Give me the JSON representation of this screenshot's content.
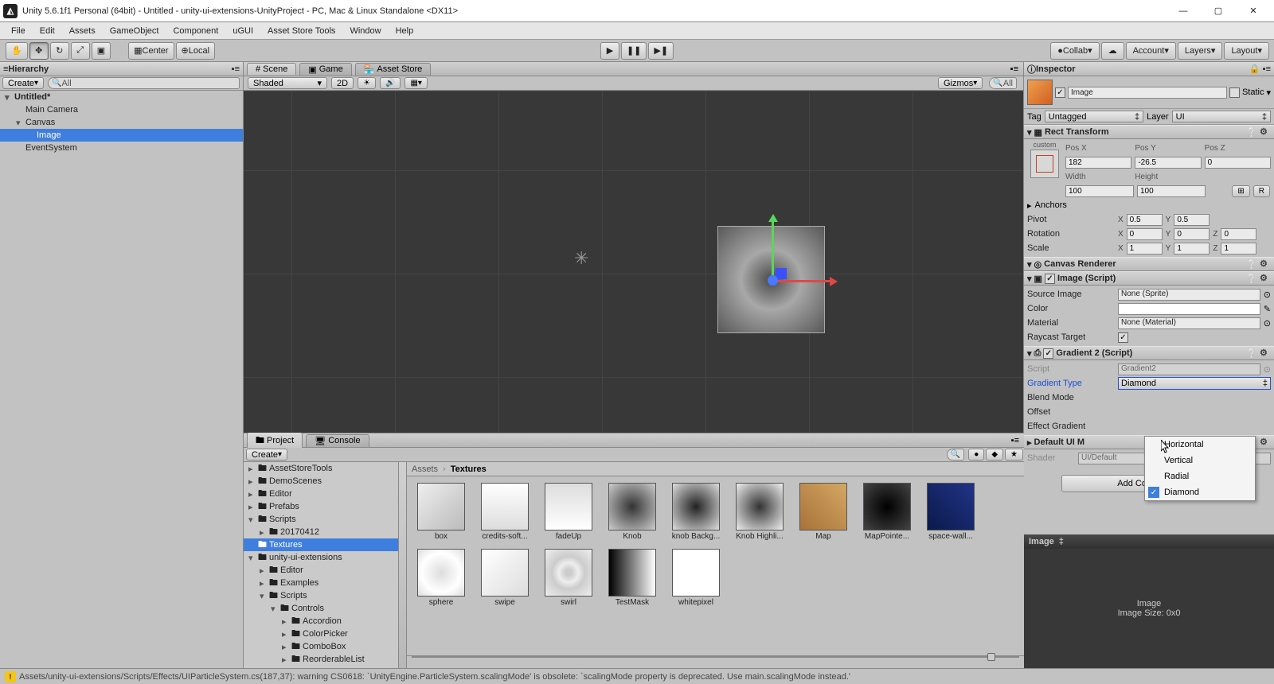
{
  "window": {
    "title": "Unity 5.6.1f1 Personal (64bit) - Untitled - unity-ui-extensions-UnityProject - PC, Mac & Linux Standalone <DX11>"
  },
  "menu": [
    "File",
    "Edit",
    "Assets",
    "GameObject",
    "Component",
    "uGUI",
    "Asset Store Tools",
    "Window",
    "Help"
  ],
  "toolbar": {
    "center": "Center",
    "local": "Local",
    "collab": "Collab",
    "account": "Account",
    "layers": "Layers",
    "layout": "Layout"
  },
  "hierarchy": {
    "tab": "Hierarchy",
    "create": "Create",
    "search_ph": "All",
    "rows": [
      {
        "label": "Untitled*",
        "depth": 0,
        "bold": true,
        "sel": false,
        "fold": "▾"
      },
      {
        "label": "Main Camera",
        "depth": 1,
        "sel": false
      },
      {
        "label": "Canvas",
        "depth": 1,
        "sel": false,
        "fold": "▾"
      },
      {
        "label": "Image",
        "depth": 2,
        "sel": true
      },
      {
        "label": "EventSystem",
        "depth": 1,
        "sel": false
      }
    ]
  },
  "scene": {
    "tabs": [
      "Scene",
      "Game",
      "Asset Store"
    ],
    "shaded": "Shaded",
    "mode2d": "2D",
    "gizmos": "Gizmos",
    "search_ph": "All"
  },
  "project": {
    "tab_project": "Project",
    "tab_console": "Console",
    "create": "Create",
    "breadcrumb": [
      "Assets",
      "Textures"
    ],
    "tree": [
      {
        "label": "AssetStoreTools",
        "depth": 0,
        "fold": "▸"
      },
      {
        "label": "DemoScenes",
        "depth": 0,
        "fold": "▸"
      },
      {
        "label": "Editor",
        "depth": 0,
        "fold": "▸"
      },
      {
        "label": "Prefabs",
        "depth": 0,
        "fold": "▸"
      },
      {
        "label": "Scripts",
        "depth": 0,
        "fold": "▾"
      },
      {
        "label": "20170412",
        "depth": 1,
        "fold": "▸"
      },
      {
        "label": "Textures",
        "depth": 0,
        "sel": true
      },
      {
        "label": "unity-ui-extensions",
        "depth": 0,
        "fold": "▾"
      },
      {
        "label": "Editor",
        "depth": 1,
        "fold": "▸"
      },
      {
        "label": "Examples",
        "depth": 1,
        "fold": "▸"
      },
      {
        "label": "Scripts",
        "depth": 1,
        "fold": "▾"
      },
      {
        "label": "Controls",
        "depth": 2,
        "fold": "▾"
      },
      {
        "label": "Accordion",
        "depth": 3,
        "fold": "▸"
      },
      {
        "label": "ColorPicker",
        "depth": 3,
        "fold": "▸"
      },
      {
        "label": "ComboBox",
        "depth": 3,
        "fold": "▸"
      },
      {
        "label": "ReorderableList",
        "depth": 3,
        "fold": "▸"
      }
    ],
    "assets": [
      "box",
      "credits-soft...",
      "fadeUp",
      "Knob",
      "knob Backg...",
      "Knob Highli...",
      "Map",
      "MapPointe...",
      "space-wall...",
      "sphere",
      "swipe",
      "swirl",
      "TestMask",
      "whitepixel"
    ]
  },
  "inspector": {
    "tab": "Inspector",
    "name": "Image",
    "static": "Static",
    "tag_label": "Tag",
    "tag_value": "Untagged",
    "layer_label": "Layer",
    "layer_value": "UI",
    "rect": {
      "title": "Rect Transform",
      "anchor_preset": "custom",
      "posx_l": "Pos X",
      "posx": "182",
      "posy_l": "Pos Y",
      "posy": "-26.5",
      "posz_l": "Pos Z",
      "posz": "0",
      "width_l": "Width",
      "width": "100",
      "height_l": "Height",
      "height": "100",
      "anchors": "Anchors",
      "pivot": "Pivot",
      "px": "0.5",
      "py": "0.5",
      "rotation": "Rotation",
      "rx": "0",
      "ry": "0",
      "rz": "0",
      "scale": "Scale",
      "sx": "1",
      "sy": "1",
      "sz": "1"
    },
    "canvas_renderer": "Canvas Renderer",
    "image_comp": {
      "title": "Image (Script)",
      "src_l": "Source Image",
      "src": "None (Sprite)",
      "color_l": "Color",
      "mat_l": "Material",
      "mat": "None (Material)",
      "ray_l": "Raycast Target"
    },
    "gradient": {
      "title": "Gradient 2 (Script)",
      "script_l": "Script",
      "script": "Gradient2",
      "type_l": "Gradient Type",
      "type": "Diamond",
      "blend_l": "Blend Mode",
      "offset_l": "Offset",
      "effect_l": "Effect Gradient"
    },
    "default_ui_mat": "Default UI M",
    "shader_l": "Shader",
    "shader": "UI/Default",
    "add_component": "Add Component",
    "preview_title": "Image",
    "preview_img": "Image",
    "preview_size": "Image Size: 0x0"
  },
  "dropdown_popup": {
    "items": [
      "Horizontal",
      "Vertical",
      "Radial",
      "Diamond"
    ],
    "selected": "Diamond"
  },
  "status": "Assets/unity-ui-extensions/Scripts/Effects/UIParticleSystem.cs(187,37): warning CS0618: `UnityEngine.ParticleSystem.scalingMode' is obsolete: `scalingMode property is deprecated. Use main.scalingMode instead.'"
}
